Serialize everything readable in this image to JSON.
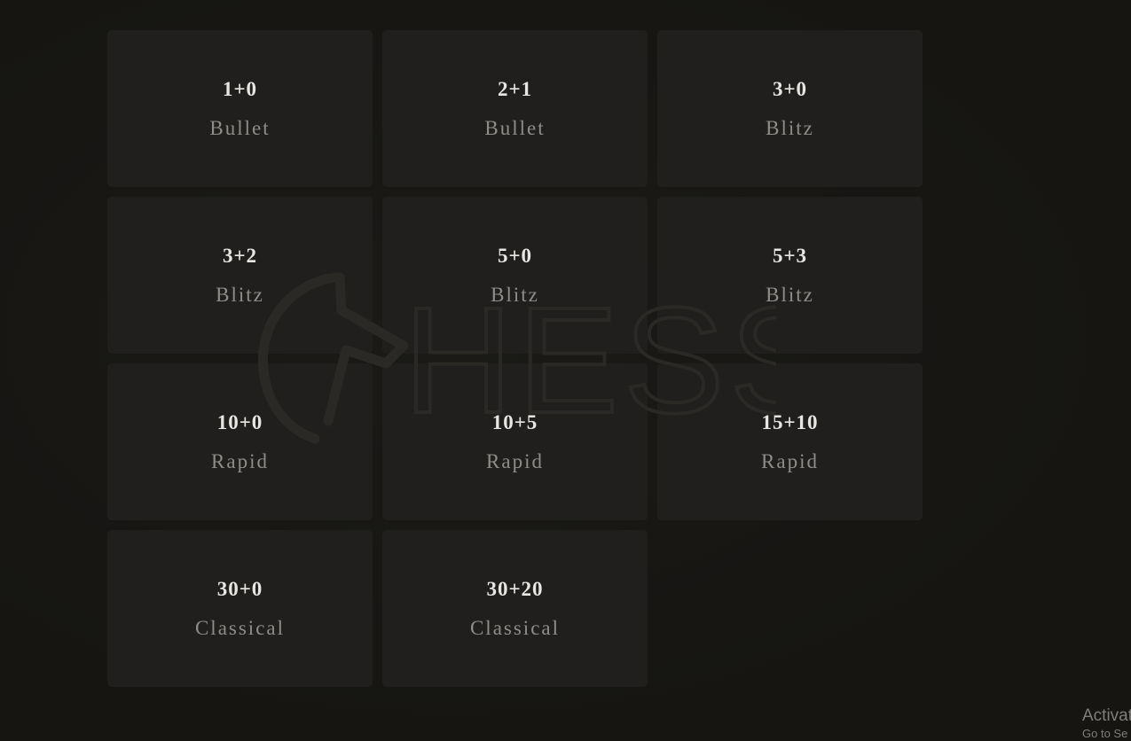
{
  "pools": [
    {
      "clock": "1+0",
      "perf": "Bullet"
    },
    {
      "clock": "2+1",
      "perf": "Bullet"
    },
    {
      "clock": "3+0",
      "perf": "Blitz"
    },
    {
      "clock": "3+2",
      "perf": "Blitz"
    },
    {
      "clock": "5+0",
      "perf": "Blitz"
    },
    {
      "clock": "5+3",
      "perf": "Blitz"
    },
    {
      "clock": "10+0",
      "perf": "Rapid"
    },
    {
      "clock": "10+5",
      "perf": "Rapid"
    },
    {
      "clock": "15+10",
      "perf": "Rapid"
    },
    {
      "clock": "30+0",
      "perf": "Classical"
    },
    {
      "clock": "30+20",
      "perf": "Classical"
    }
  ],
  "watermark": {
    "icon": "knight-logo-icon",
    "text": "HESS"
  },
  "os_overlay": {
    "line1": "Activat",
    "line2": "Go to Se"
  },
  "colors": {
    "background": "#161512",
    "tile": "#201f1d",
    "clock_text": "#e8e6e3",
    "perf_text": "#8f8d89"
  }
}
